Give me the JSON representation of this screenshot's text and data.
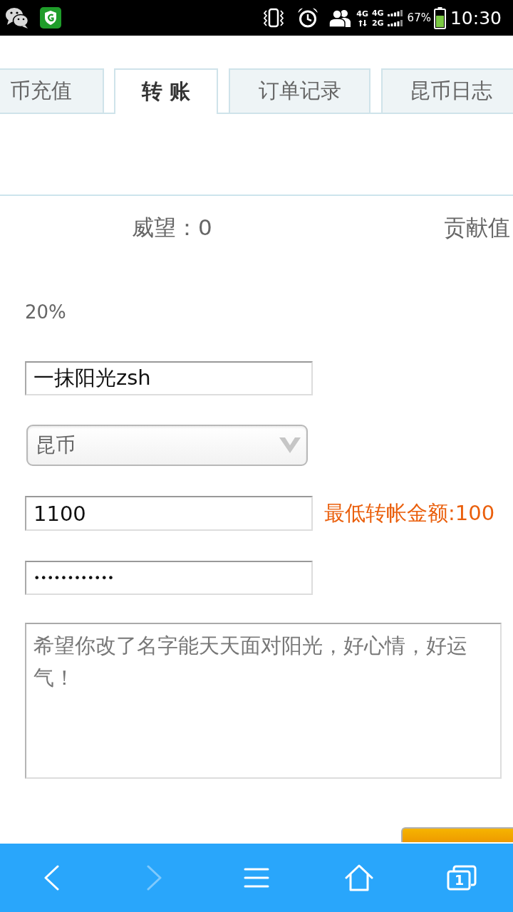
{
  "status_bar": {
    "network_labels": [
      "4G",
      "4G",
      "2G"
    ],
    "battery_percent": "67%",
    "time": "10:30"
  },
  "tabs": [
    {
      "label": "币充值",
      "selected": false
    },
    {
      "label": "转 账",
      "selected": true
    },
    {
      "label": "订单记录",
      "selected": false
    },
    {
      "label": "昆币日志",
      "selected": false
    }
  ],
  "stats": [
    {
      "text": "威望：0"
    },
    {
      "text": "贡献值"
    }
  ],
  "rate": "20%",
  "form": {
    "recipient": {
      "value": "一抹阳光zsh"
    },
    "currency": {
      "value": "昆币"
    },
    "amount": {
      "value": "1100",
      "hint": "最低转帐金额:100"
    },
    "password": {
      "value": "••••••••••••"
    },
    "message": {
      "value": "希望你改了名字能天天面对阳光，好心情，好运气！"
    }
  },
  "bottom_bar": {
    "buttons": [
      {
        "kind": "back",
        "disabled": false
      },
      {
        "kind": "forward",
        "disabled": true
      },
      {
        "kind": "menu",
        "disabled": false
      },
      {
        "kind": "home",
        "disabled": false
      },
      {
        "kind": "tabs",
        "disabled": false,
        "count": "1"
      }
    ]
  }
}
